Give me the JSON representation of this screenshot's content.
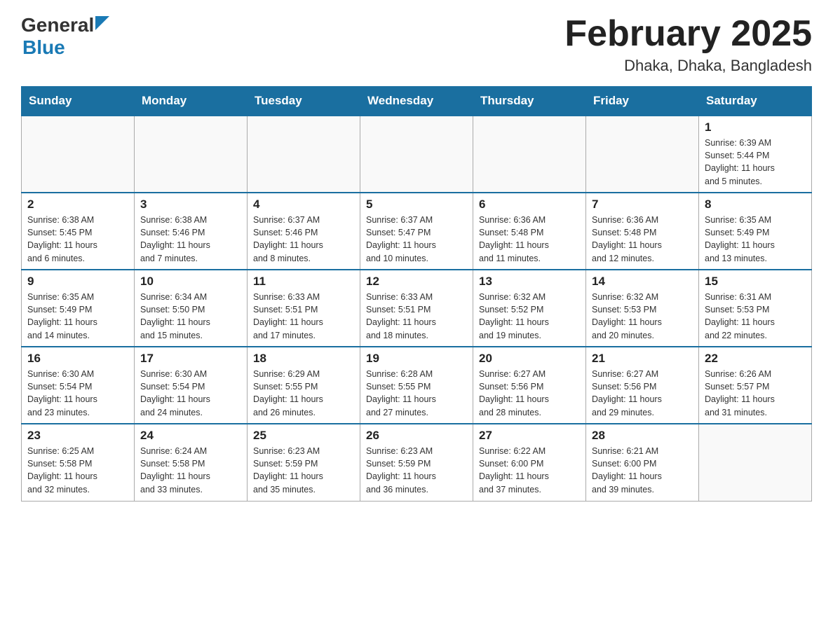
{
  "header": {
    "logo_general": "General",
    "logo_blue": "Blue",
    "month_title": "February 2025",
    "location": "Dhaka, Dhaka, Bangladesh"
  },
  "weekdays": [
    "Sunday",
    "Monday",
    "Tuesday",
    "Wednesday",
    "Thursday",
    "Friday",
    "Saturday"
  ],
  "weeks": [
    [
      {
        "day": "",
        "info": ""
      },
      {
        "day": "",
        "info": ""
      },
      {
        "day": "",
        "info": ""
      },
      {
        "day": "",
        "info": ""
      },
      {
        "day": "",
        "info": ""
      },
      {
        "day": "",
        "info": ""
      },
      {
        "day": "1",
        "info": "Sunrise: 6:39 AM\nSunset: 5:44 PM\nDaylight: 11 hours\nand 5 minutes."
      }
    ],
    [
      {
        "day": "2",
        "info": "Sunrise: 6:38 AM\nSunset: 5:45 PM\nDaylight: 11 hours\nand 6 minutes."
      },
      {
        "day": "3",
        "info": "Sunrise: 6:38 AM\nSunset: 5:46 PM\nDaylight: 11 hours\nand 7 minutes."
      },
      {
        "day": "4",
        "info": "Sunrise: 6:37 AM\nSunset: 5:46 PM\nDaylight: 11 hours\nand 8 minutes."
      },
      {
        "day": "5",
        "info": "Sunrise: 6:37 AM\nSunset: 5:47 PM\nDaylight: 11 hours\nand 10 minutes."
      },
      {
        "day": "6",
        "info": "Sunrise: 6:36 AM\nSunset: 5:48 PM\nDaylight: 11 hours\nand 11 minutes."
      },
      {
        "day": "7",
        "info": "Sunrise: 6:36 AM\nSunset: 5:48 PM\nDaylight: 11 hours\nand 12 minutes."
      },
      {
        "day": "8",
        "info": "Sunrise: 6:35 AM\nSunset: 5:49 PM\nDaylight: 11 hours\nand 13 minutes."
      }
    ],
    [
      {
        "day": "9",
        "info": "Sunrise: 6:35 AM\nSunset: 5:49 PM\nDaylight: 11 hours\nand 14 minutes."
      },
      {
        "day": "10",
        "info": "Sunrise: 6:34 AM\nSunset: 5:50 PM\nDaylight: 11 hours\nand 15 minutes."
      },
      {
        "day": "11",
        "info": "Sunrise: 6:33 AM\nSunset: 5:51 PM\nDaylight: 11 hours\nand 17 minutes."
      },
      {
        "day": "12",
        "info": "Sunrise: 6:33 AM\nSunset: 5:51 PM\nDaylight: 11 hours\nand 18 minutes."
      },
      {
        "day": "13",
        "info": "Sunrise: 6:32 AM\nSunset: 5:52 PM\nDaylight: 11 hours\nand 19 minutes."
      },
      {
        "day": "14",
        "info": "Sunrise: 6:32 AM\nSunset: 5:53 PM\nDaylight: 11 hours\nand 20 minutes."
      },
      {
        "day": "15",
        "info": "Sunrise: 6:31 AM\nSunset: 5:53 PM\nDaylight: 11 hours\nand 22 minutes."
      }
    ],
    [
      {
        "day": "16",
        "info": "Sunrise: 6:30 AM\nSunset: 5:54 PM\nDaylight: 11 hours\nand 23 minutes."
      },
      {
        "day": "17",
        "info": "Sunrise: 6:30 AM\nSunset: 5:54 PM\nDaylight: 11 hours\nand 24 minutes."
      },
      {
        "day": "18",
        "info": "Sunrise: 6:29 AM\nSunset: 5:55 PM\nDaylight: 11 hours\nand 26 minutes."
      },
      {
        "day": "19",
        "info": "Sunrise: 6:28 AM\nSunset: 5:55 PM\nDaylight: 11 hours\nand 27 minutes."
      },
      {
        "day": "20",
        "info": "Sunrise: 6:27 AM\nSunset: 5:56 PM\nDaylight: 11 hours\nand 28 minutes."
      },
      {
        "day": "21",
        "info": "Sunrise: 6:27 AM\nSunset: 5:56 PM\nDaylight: 11 hours\nand 29 minutes."
      },
      {
        "day": "22",
        "info": "Sunrise: 6:26 AM\nSunset: 5:57 PM\nDaylight: 11 hours\nand 31 minutes."
      }
    ],
    [
      {
        "day": "23",
        "info": "Sunrise: 6:25 AM\nSunset: 5:58 PM\nDaylight: 11 hours\nand 32 minutes."
      },
      {
        "day": "24",
        "info": "Sunrise: 6:24 AM\nSunset: 5:58 PM\nDaylight: 11 hours\nand 33 minutes."
      },
      {
        "day": "25",
        "info": "Sunrise: 6:23 AM\nSunset: 5:59 PM\nDaylight: 11 hours\nand 35 minutes."
      },
      {
        "day": "26",
        "info": "Sunrise: 6:23 AM\nSunset: 5:59 PM\nDaylight: 11 hours\nand 36 minutes."
      },
      {
        "day": "27",
        "info": "Sunrise: 6:22 AM\nSunset: 6:00 PM\nDaylight: 11 hours\nand 37 minutes."
      },
      {
        "day": "28",
        "info": "Sunrise: 6:21 AM\nSunset: 6:00 PM\nDaylight: 11 hours\nand 39 minutes."
      },
      {
        "day": "",
        "info": ""
      }
    ]
  ]
}
